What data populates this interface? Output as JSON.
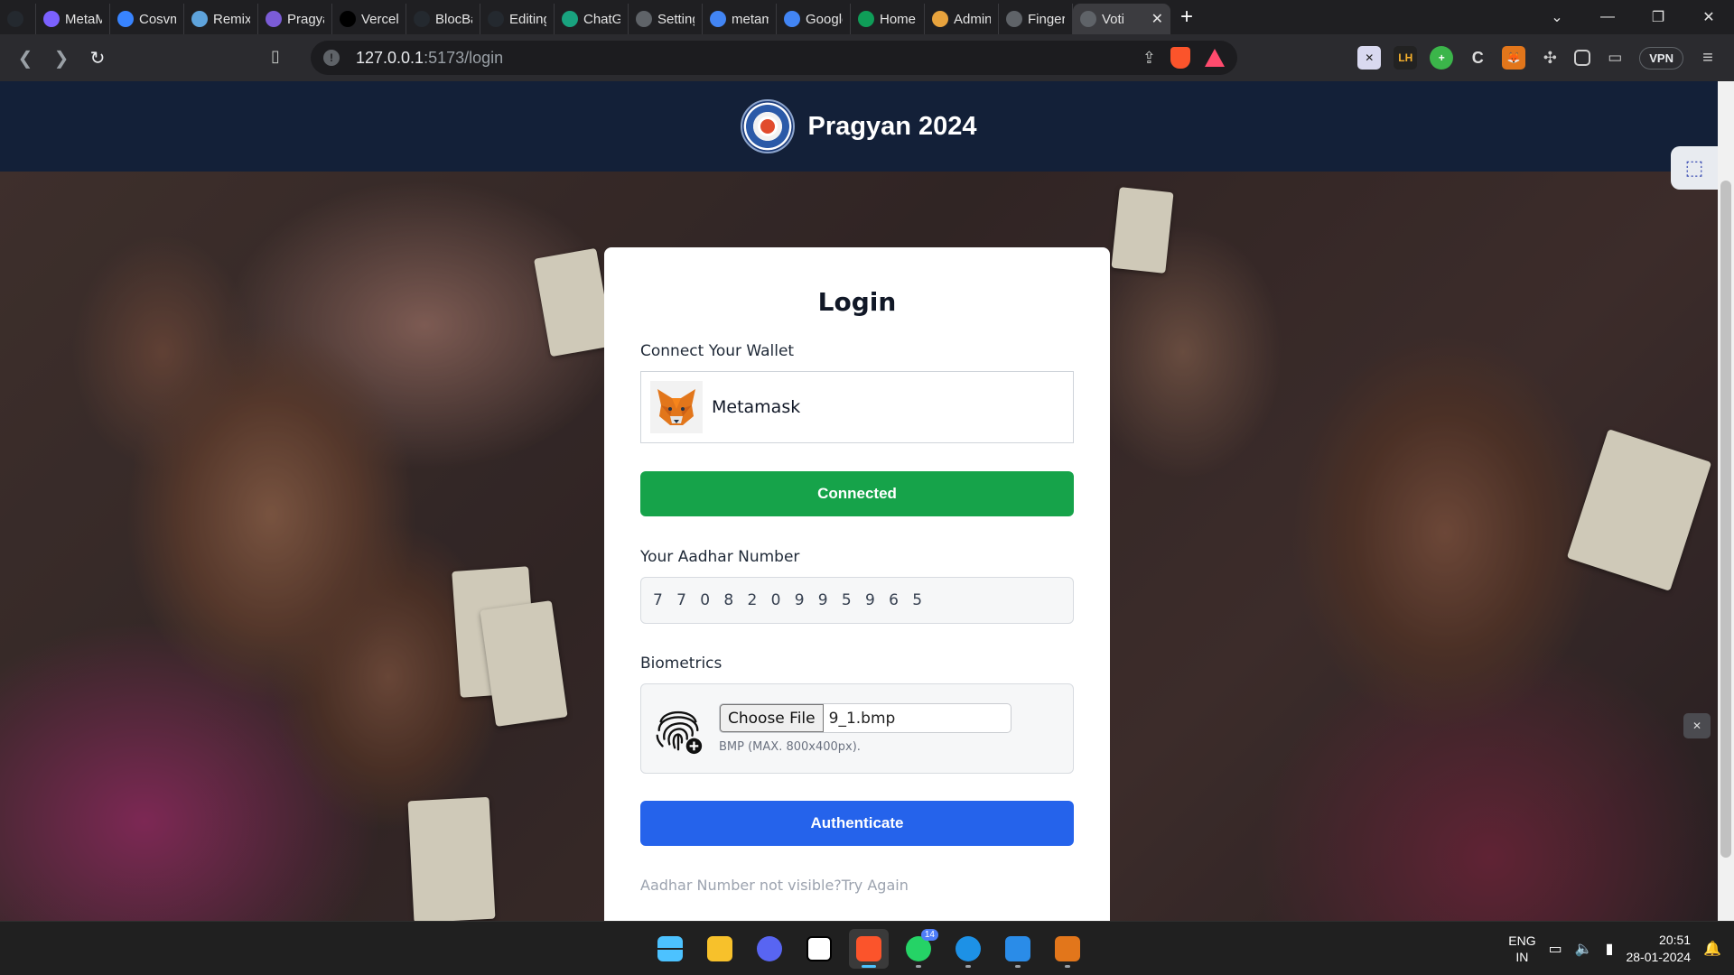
{
  "browser": {
    "tabs": [
      {
        "label": "",
        "icon": "github-icon",
        "color": "#24292f"
      },
      {
        "label": "MetaMa",
        "icon": "metamask-v-icon",
        "color": "#7b61ff"
      },
      {
        "label": "Cosvm v",
        "icon": "gitbook-icon",
        "color": "#3884ff"
      },
      {
        "label": "Remix - E",
        "icon": "remix-icon",
        "color": "#5ea3dc"
      },
      {
        "label": "Pragyan",
        "icon": "forms-icon",
        "color": "#7b5cd6"
      },
      {
        "label": "Vercel –",
        "icon": "vercel-icon",
        "color": "#000000"
      },
      {
        "label": "BlocBallo",
        "icon": "github-icon",
        "color": "#24292f"
      },
      {
        "label": "Editing E",
        "icon": "github-icon",
        "color": "#24292f"
      },
      {
        "label": "ChatGPT",
        "icon": "chatgpt-icon",
        "color": "#19a37f"
      },
      {
        "label": "Settings",
        "icon": "gear-icon",
        "color": "#5f6368"
      },
      {
        "label": "metamsk",
        "icon": "google-icon",
        "color": "#4285f4"
      },
      {
        "label": "Google A",
        "icon": "google-icon",
        "color": "#4285f4"
      },
      {
        "label": "Home -",
        "icon": "drive-icon",
        "color": "#0f9d58"
      },
      {
        "label": "Admin P",
        "icon": "admin-icon",
        "color": "#e8a33d"
      },
      {
        "label": "Fingerpr",
        "icon": "globe-icon",
        "color": "#5f6368"
      }
    ],
    "active_tab": {
      "label": "Voti",
      "icon": "voting-icon"
    },
    "url_host": "127.0.0.1",
    "url_path": ":5173/login",
    "vpn_label": "VPN"
  },
  "page": {
    "site_title": "Pragyan 2024",
    "login": {
      "title": "Login",
      "wallet_label": "Connect Your Wallet",
      "wallet_name": "Metamask",
      "connected_button": "Connected",
      "aadhar_label": "Your Aadhar Number",
      "aadhar_value": "770820995965",
      "biometrics_label": "Biometrics",
      "choose_file": "Choose File",
      "file_name": "9_1.bmp",
      "file_hint": "BMP (MAX. 800x400px).",
      "authenticate_button": "Authenticate",
      "retry_text": "Aadhar Number not visible?Try Again"
    }
  },
  "taskbar": {
    "apps": [
      {
        "icon": "windows-start-icon",
        "active": false
      },
      {
        "icon": "file-explorer-icon",
        "active": false
      },
      {
        "icon": "discord-icon",
        "active": false
      },
      {
        "icon": "notion-icon",
        "active": false
      },
      {
        "icon": "brave-icon",
        "active": true
      },
      {
        "icon": "whatsapp-icon",
        "active": false,
        "badge": "14"
      },
      {
        "icon": "docker-icon",
        "active": false
      },
      {
        "icon": "vscode-icon",
        "active": false
      },
      {
        "icon": "metamask-icon",
        "active": false
      }
    ],
    "lang_line1": "ENG",
    "lang_line2": "IN",
    "time": "20:51",
    "date": "28-01-2024"
  },
  "colors": {
    "header_bg": "#132038",
    "connected_green": "#16a34a",
    "authenticate_blue": "#2563eb"
  }
}
